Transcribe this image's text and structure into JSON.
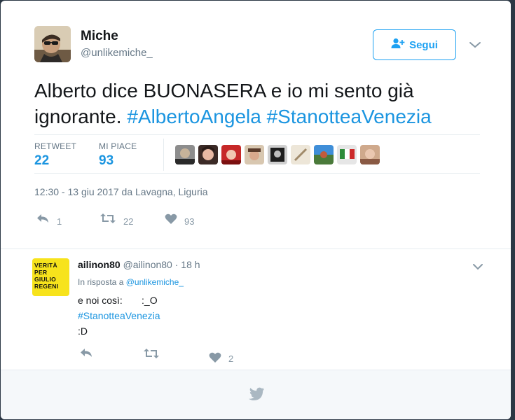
{
  "tweet": {
    "author_name": "Miche",
    "author_handle": "@unlikemiche_",
    "follow_label": "Segui",
    "text_plain": "Alberto dice BUONASERA e io mi sento già ignorante.",
    "hashtag_1": "#AlbertoAngela",
    "hashtag_2": "#StanotteaVenezia",
    "retweet_label": "RETWEET",
    "retweet_count": "22",
    "likes_label": "MI PIACE",
    "likes_count": "93",
    "timestamp": "12:30 - 13 giu 2017 da Lavagna, Liguria",
    "reply_count": "1",
    "retweet_action_count": "22",
    "like_action_count": "93"
  },
  "reply": {
    "avatar_lines": [
      "VERITÀ",
      "PER",
      "GIULIO",
      "REGENI"
    ],
    "name": "ailinon80",
    "handle": "@ailinon80",
    "time": "· 18 h",
    "in_reply_prefix": "In risposta a",
    "in_reply_handle": "@unlikemiche_",
    "line_1": "e noi così:       :_O",
    "line_2": "#StanotteaVenezia",
    "line_3": ":D",
    "like_count": "2"
  },
  "colors": {
    "accent": "#1da1f2",
    "link": "#1b95e0",
    "muted": "#657786",
    "reply_avatar_bg": "#f7e31c"
  },
  "icons": [
    "user-plus-icon",
    "chevron-down-icon",
    "reply-icon",
    "retweet-icon",
    "heart-icon",
    "twitter-bird-icon"
  ]
}
